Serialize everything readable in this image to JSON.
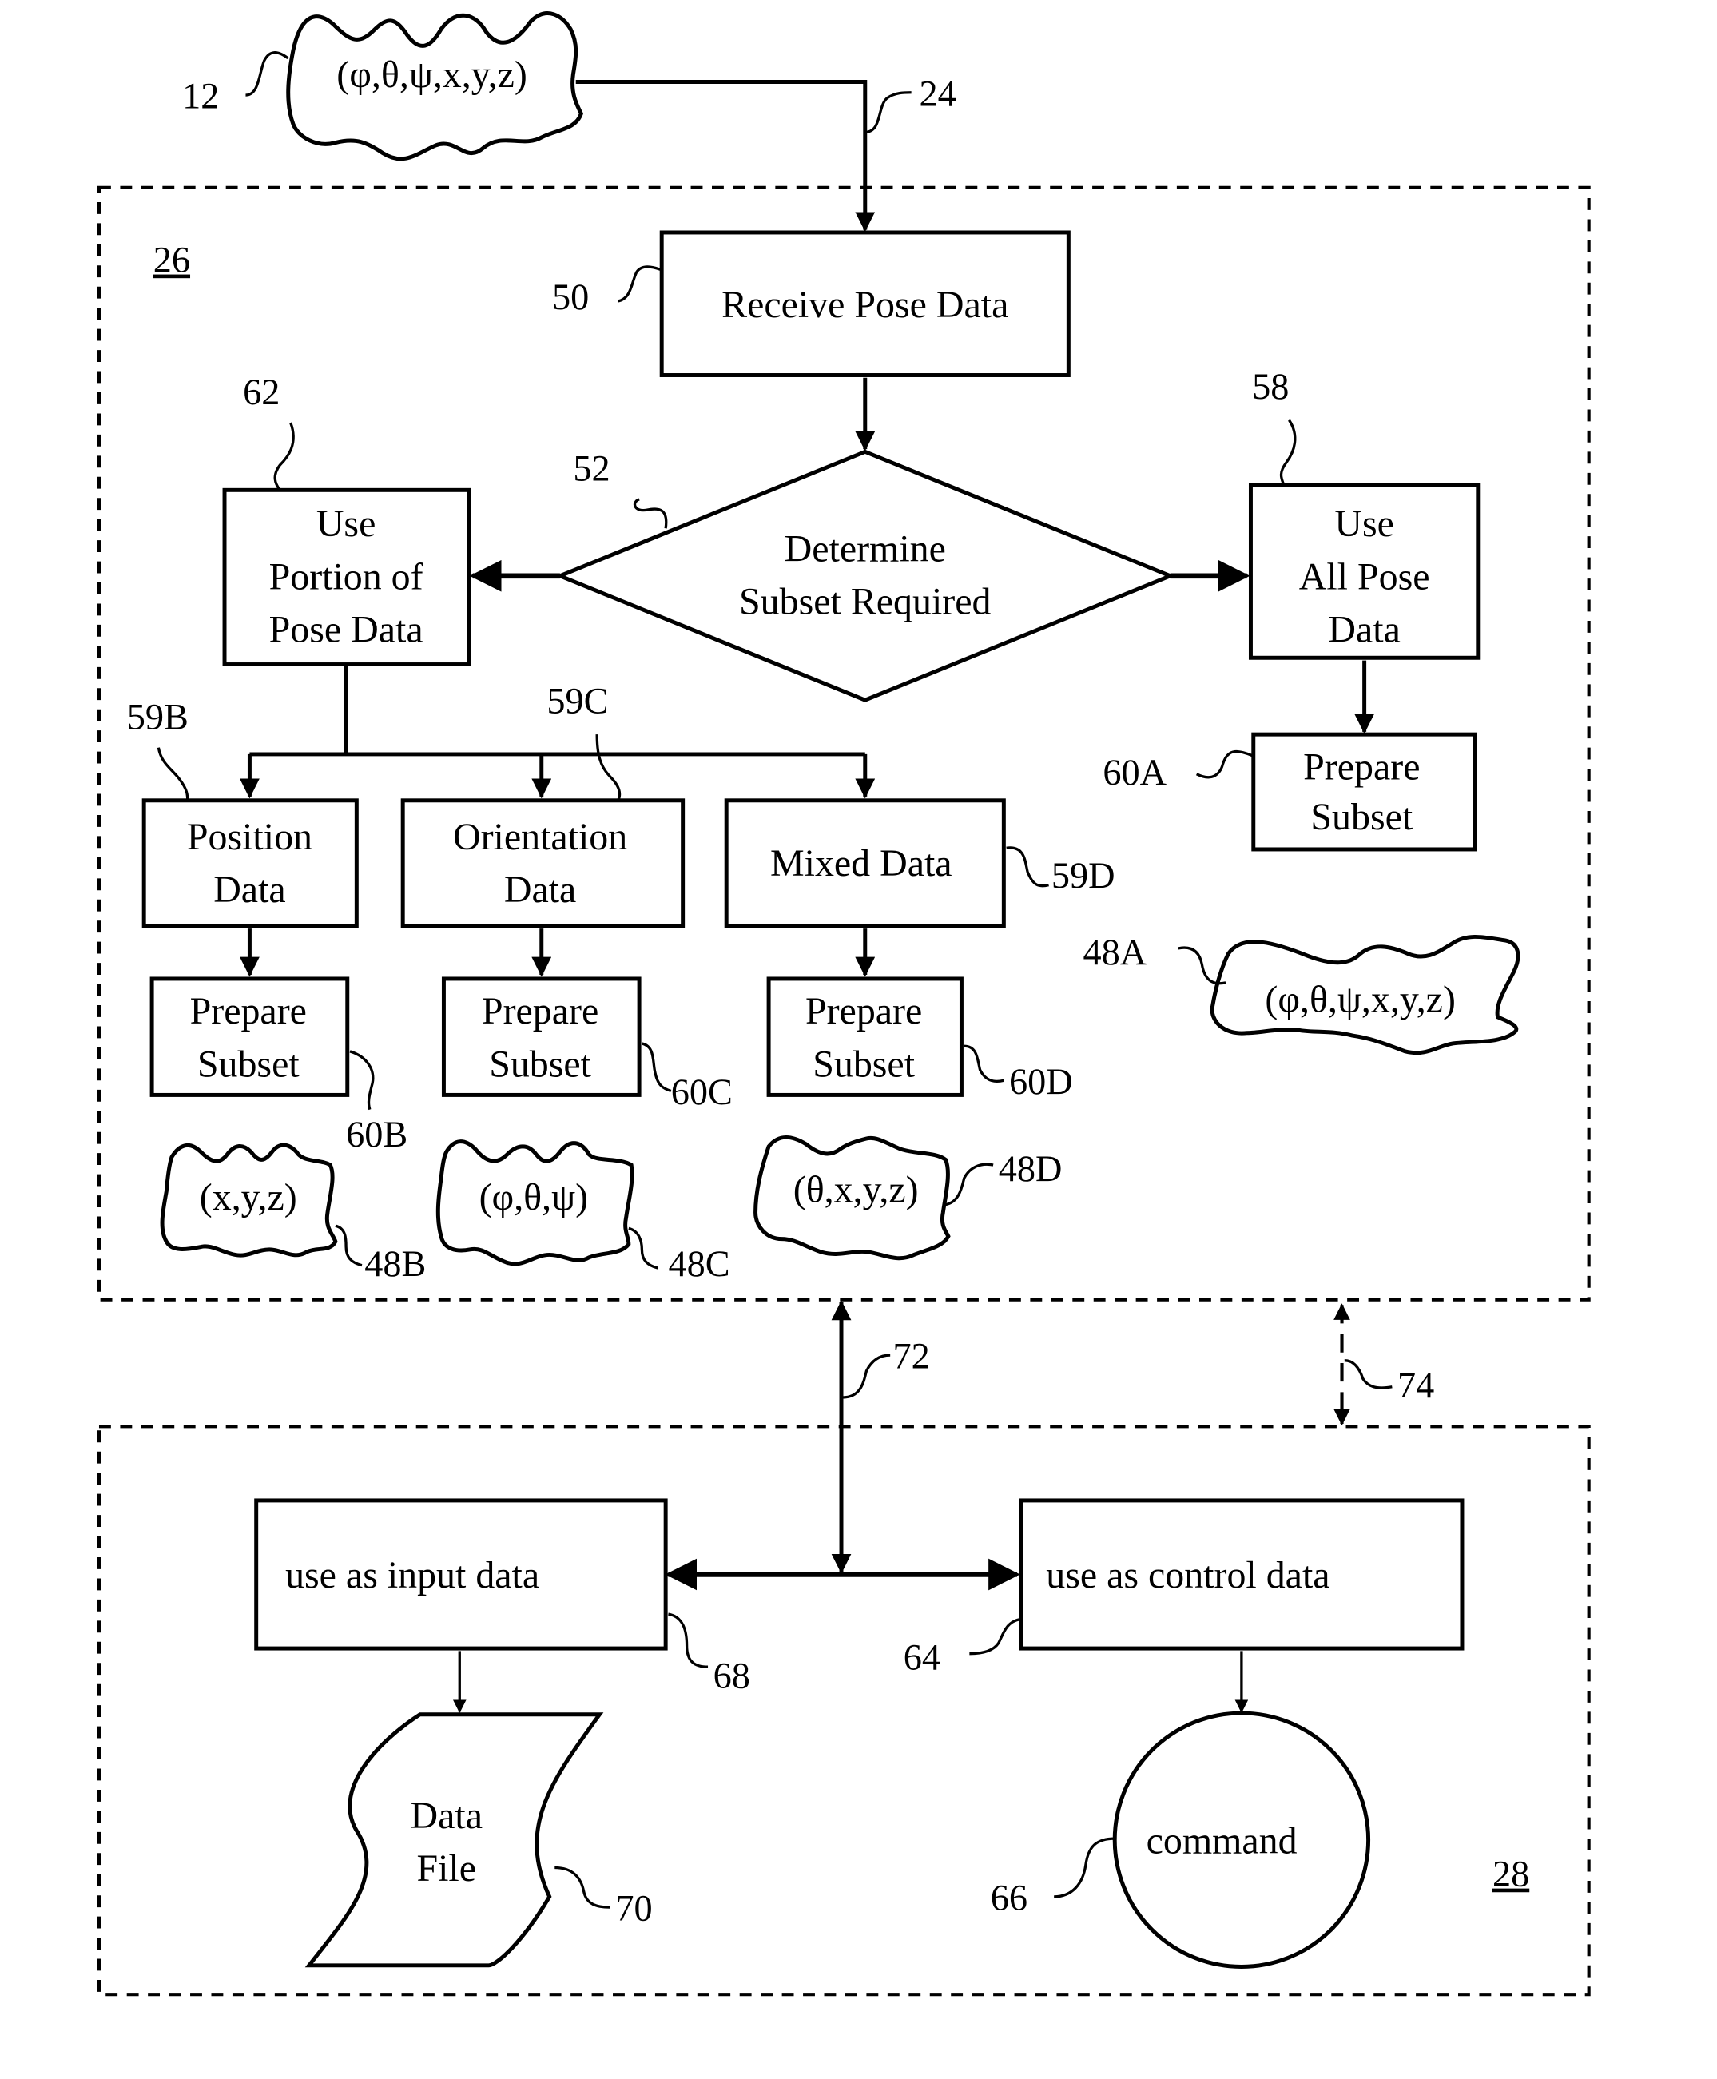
{
  "figure": {
    "input_pose": {
      "ref": "12",
      "text": "(φ,θ,ψ,x,y,z)"
    },
    "input_connector": {
      "ref": "24"
    },
    "module_top": {
      "ref": "26"
    },
    "module_bottom": {
      "ref": "28"
    },
    "receive": {
      "ref": "50",
      "text": "Receive Pose Data"
    },
    "decision": {
      "ref": "52",
      "lines": [
        "Determine",
        "Subset Required"
      ]
    },
    "use_portion": {
      "ref": "62",
      "lines": [
        "Use",
        "Portion of",
        "Pose Data"
      ]
    },
    "use_all": {
      "ref": "58",
      "lines": [
        "Use",
        "All Pose",
        "Data"
      ]
    },
    "prepare_a": {
      "ref": "60A",
      "lines": [
        "Prepare",
        "Subset"
      ]
    },
    "position": {
      "ref": "59B",
      "lines": [
        "Position",
        "Data"
      ]
    },
    "orientation": {
      "ref": "59C",
      "lines": [
        "Orientation",
        "Data"
      ]
    },
    "mixed": {
      "ref": "59D",
      "text": "Mixed Data"
    },
    "prepare_b": {
      "ref": "60B",
      "lines": [
        "Prepare",
        "Subset"
      ]
    },
    "prepare_c": {
      "ref": "60C",
      "lines": [
        "Prepare",
        "Subset"
      ]
    },
    "prepare_d": {
      "ref": "60D",
      "lines": [
        "Prepare",
        "Subset"
      ]
    },
    "subset_a": {
      "ref": "48A",
      "text": "(φ,θ,ψ,x,y,z)"
    },
    "subset_b": {
      "ref": "48B",
      "text": "(x,y,z)"
    },
    "subset_c": {
      "ref": "48C",
      "text": "(φ,θ,ψ)"
    },
    "subset_d": {
      "ref": "48D",
      "text": "(θ,x,y,z)"
    },
    "link_main": {
      "ref": "72"
    },
    "link_alt": {
      "ref": "74"
    },
    "input_data": {
      "ref": "68",
      "text": "use as input data"
    },
    "control_data": {
      "ref": "64",
      "text": "use as control data"
    },
    "data_file": {
      "ref": "70",
      "lines": [
        "Data",
        "File"
      ]
    },
    "command": {
      "ref": "66",
      "text": "command"
    }
  }
}
